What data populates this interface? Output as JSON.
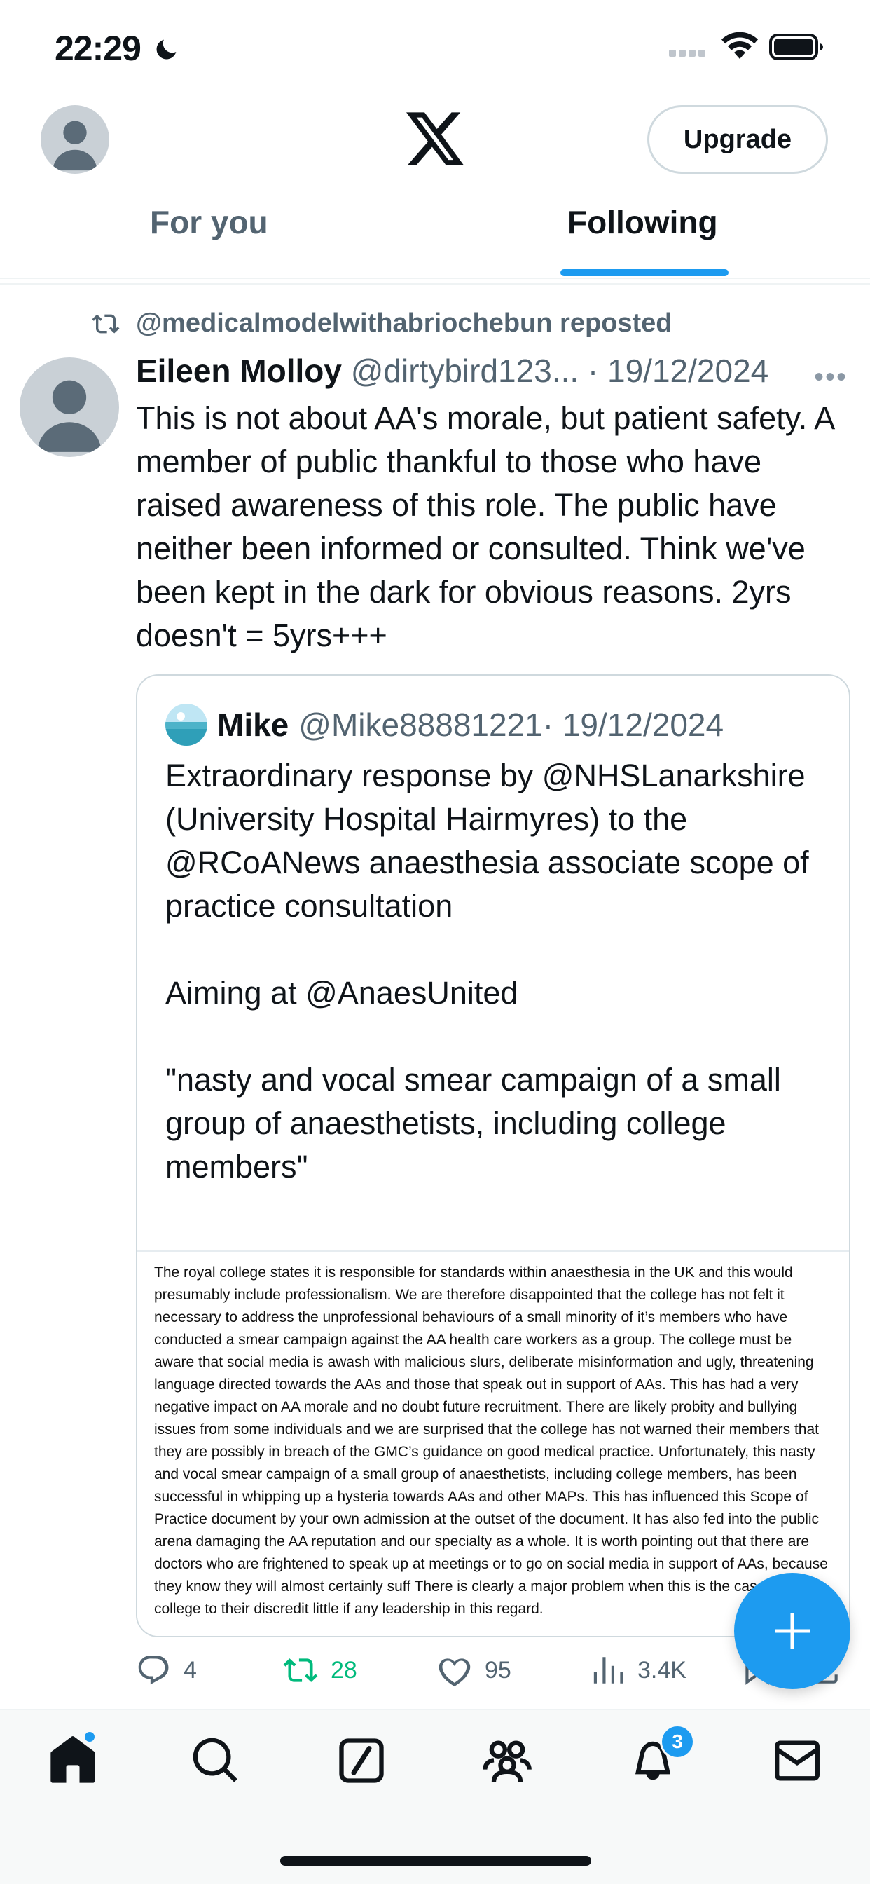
{
  "status_bar": {
    "time": "22:29"
  },
  "header": {
    "upgrade_label": "Upgrade"
  },
  "tabs": [
    {
      "label": "For you",
      "active": false
    },
    {
      "label": "Following",
      "active": true
    }
  ],
  "tweet": {
    "reposted_by": "@medicalmodelwithabriochebun reposted",
    "author_name": "Eileen Molloy",
    "author_handle": "@dirtybird123...",
    "date": "· 19/12/2024",
    "text": "This is not about AA's morale, but patient safety. A member of public thankful to those who have raised awareness of this role. The public have neither been informed or consulted. Think we've been kept in the dark for obvious reasons. 2yrs doesn't = 5yrs+++",
    "quote": {
      "author_name": "Mike",
      "author_handle": "@Mike88881221",
      "date": "· 19/12/2024",
      "text": "Extraordinary response by @NHSLanarkshire (University Hospital Hairmyres) to the @RCoANews anaesthesia associate scope of practice consultation\n\nAiming at @AnaesUnited\n\n\"nasty and vocal smear campaign of a small group of anaesthetists, including college members\"",
      "image_text": "The royal college states it is responsible for standards within anaesthesia in the UK and this would presumably include professionalism. We are therefore disappointed that the college has not felt it necessary to address the unprofessional behaviours of a small minority of it’s members who have conducted a smear campaign against the AA health care workers as a group. The college must be aware that social media is awash with malicious slurs, deliberate misinformation and ugly, threatening language directed towards the AAs and those that speak out in support of AAs. This has had a very negative impact on AA morale and no doubt future recruitment. There are likely probity and bullying issues from some individuals and we are surprised that the college has not warned their members that they are possibly in breach of the GMC’s guidance on good medical practice. Unfortunately, this nasty and vocal smear campaign of a small group of anaesthetists, including college members, has been successful in whipping up a hysteria towards AAs and other MAPs. This has influenced this Scope of Practice document by your own admission at the outset of the document. It has also fed into the public arena damaging the AA reputation and our specialty as a whole. It is worth pointing out that there are doctors who are frightened to speak up at meetings or to go on social media in support of AAs, because they know they will almost certainly suff There is clearly a major problem when this is the case and the college to their discredit little if any leadership in this regard."
    },
    "stats": {
      "replies": "4",
      "reposts": "28",
      "likes": "95",
      "views": "3.4K"
    }
  },
  "bottom_nav": {
    "notifications_badge": "3"
  },
  "colors": {
    "accent": "#1d9bf0",
    "repost_green": "#00ba7c",
    "secondary_text": "#536471"
  }
}
